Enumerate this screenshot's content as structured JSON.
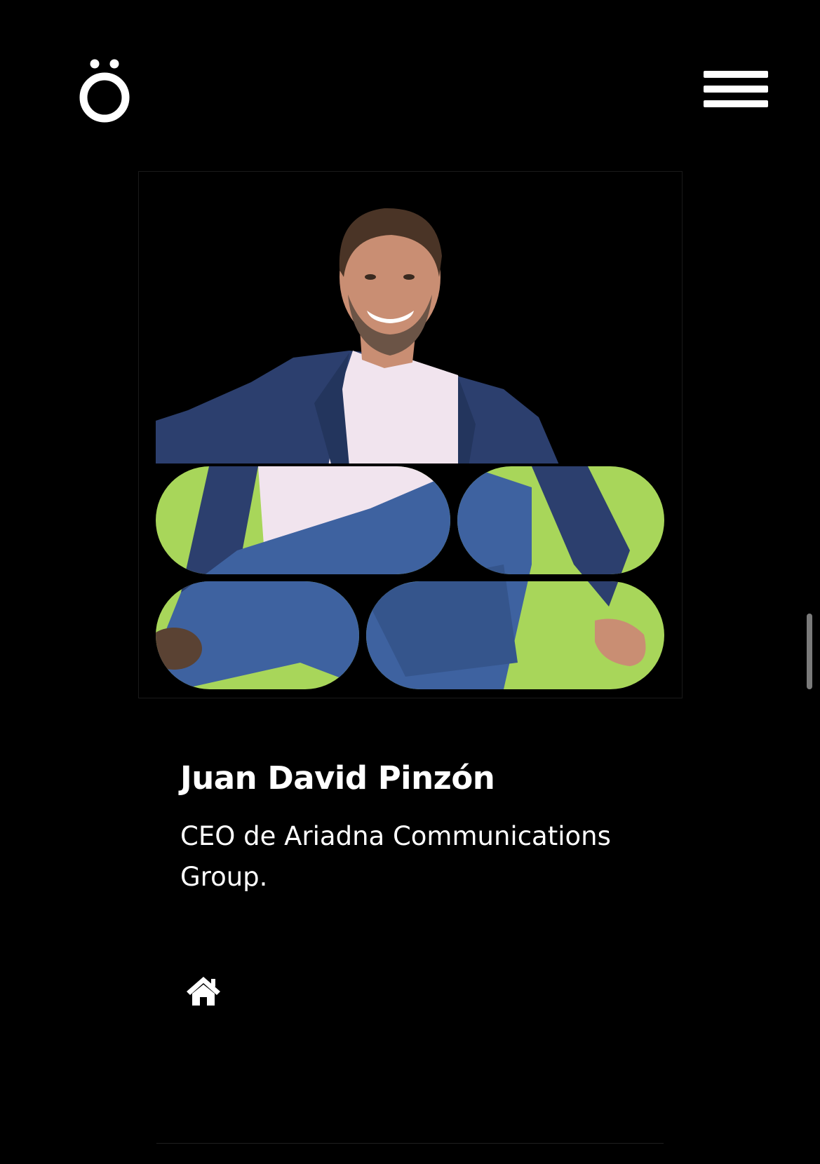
{
  "header": {
    "logo_glyph": "ö",
    "logo_icon": "o-umlaut-logo",
    "menu_icon": "hamburger-menu-icon"
  },
  "profile": {
    "name": "Juan David Pinzón",
    "role": "CEO de Ariadna Communications Group.",
    "photo_description_icon": "profile-photo"
  },
  "footer": {
    "home_icon": "home-icon"
  },
  "colors": {
    "background": "#000000",
    "text": "#ffffff",
    "accent_green": "#a8d65a",
    "jacket": "#2c3f6e",
    "jeans": "#3e62a0",
    "shirt": "#f1e4ee",
    "skin": "#c98e73"
  }
}
